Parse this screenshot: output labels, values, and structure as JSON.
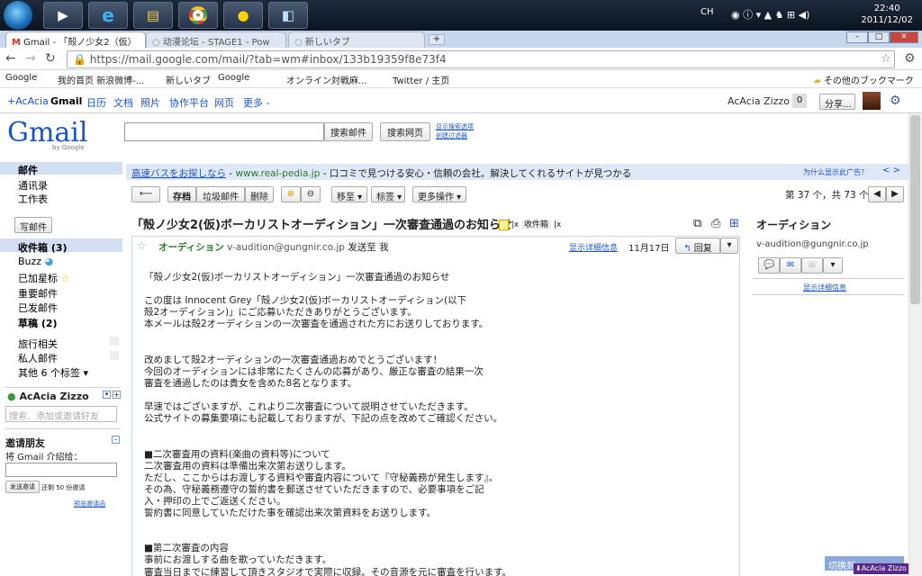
{
  "taskbar": {
    "ime": "CH",
    "time": "22:40",
    "date": "2011/12/02",
    "start_icon": "windows-orb-icon",
    "apps": [
      "media-player-icon",
      "ie-icon",
      "explorer-icon",
      "chrome-icon",
      "qq-icon",
      "notepad-icon"
    ]
  },
  "tabs": [
    {
      "label": "Gmail - 「殻ノ少女2（仮）"
    },
    {
      "label": "动漫论坛 - STAGE1 - Pow"
    },
    {
      "label": "新しいタブ"
    }
  ],
  "address": {
    "url": "https://mail.google.com/mail/?tab=wm#inbox/133b19359f8e73f4"
  },
  "bookmarks": [
    "Google",
    "我的首页 新浪微博-...",
    "新しいタブ",
    "Google",
    "新しいタブ",
    "オンライン対戦麻...",
    "Twitter / 主页"
  ],
  "bookmarks_other": "その他のブックマーク",
  "gbar": {
    "left": [
      "+AcAcia",
      "Gmail",
      "日历",
      "文档",
      "照片",
      "协作平台",
      "网页",
      "更多 -"
    ],
    "user": "AcAcia Zizzo",
    "count": "0",
    "share": "分享..."
  },
  "search": {
    "mail_btn": "搜索邮件",
    "web_btn": "搜索网页",
    "opt1": "显示搜索选项",
    "opt2": "创建过滤器"
  },
  "logo": {
    "name": "Gmail",
    "sub": "by Google"
  },
  "sidebar": {
    "top": [
      "邮件",
      "通讯录",
      "工作表"
    ],
    "compose": "写邮件",
    "folders": [
      "收件箱 (3)",
      "Buzz",
      "已加星标",
      "重要邮件",
      "已发邮件",
      "草稿 (2)"
    ],
    "labels": [
      "旅行相关",
      "私人邮件",
      "其他 6 个标签 ▾"
    ],
    "chat_name": "AcAcia Zizzo",
    "chat_placeholder": "搜索、添加或邀请好友",
    "invite_title": "邀请朋友",
    "invite_sub": "将 Gmail 介绍给：",
    "invite_btn": "发送邀请",
    "invite_left": "还剩 50 份邀请",
    "invite_preview": "预览邀请函"
  },
  "ad": {
    "text": "高速バスをお探しなら",
    "url": "www.real-pedia.jp",
    "desc": "- 口コミで見つける安心・信頼の会社。解決してくれるサイトが見つかる",
    "why": "为什么显示此广告？"
  },
  "toolbar": {
    "archive": "存档",
    "spam": "垃圾邮件",
    "delete": "删除",
    "move": "移至 ▾",
    "label": "标签 ▾",
    "more": "更多操作 ▾",
    "pager": "第 37 个，共 73 个"
  },
  "email": {
    "subject": "「殻ノ少女2(仮)ボーカリストオーディション」一次審査通過のお知らせ",
    "tag": "收件箱",
    "sender": "オーディション",
    "sender_email": "v-audition@gungnir.co.jp",
    "to": "发送至 我",
    "details": "显示详细信息",
    "date": "11月17日",
    "reply": "回复",
    "body": [
      "「殻ノ少女2(仮)ボーカリストオーディション」一次審査通過のお知らせ",
      "",
      "この度は Innocent Grey「殻ノ少女2(仮)ボーカリストオーディション(以下",
      "殻2オーディション)」にご応募いただきありがとうございます。",
      "本メールは殻2オーディションの一次審査を通過された方にお送りしております。",
      "",
      "",
      "改めまして殻2オーディションの一次審査通過おめでとうございます！",
      "今回のオーディションには非常にたくさんの応募があり、厳正な審査の結果一次",
      "審査を通過したのは貴女を含めた8名となります。",
      "",
      "早速ではございますが、これより二次審査について説明させていただきます。",
      "公式サイトの募集要項にも記載しておりますが、下記の点を改めてご確認ください。",
      "",
      "",
      "■二次審査用の資料(楽曲の資料等)について",
      "二次審査用の資料は準備出来次第お送りします。",
      "ただし、ここからはお渡しする資料や審査内容について『守秘義務が発生します』。",
      "その為、守秘義務遵守の誓約書を郵送させていただきますので、必要事項をご記",
      "入・押印の上でご返送ください。",
      "誓約書に同意していただけた事を確認出来次第資料をお送りします。",
      "",
      "",
      "■第二次審査の内容",
      "事前にお渡しする曲を歌っていただきます。",
      "審査当日までに練習して頂きスタジオで実際に収録。その音源を元に審査を行います。"
    ]
  },
  "contact": {
    "name": "オーディション",
    "email": "v-audition@gungnir.co.jp",
    "details": "显示详细信息"
  },
  "chatbar": "AcAcia Zizzo",
  "chatbar_switch": "切换到"
}
